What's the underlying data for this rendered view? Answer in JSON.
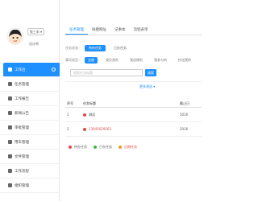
{
  "sidebar": {
    "user_button": "张三丰 ▾",
    "user_role": "设计师",
    "items": [
      {
        "label": "工作台",
        "active": true
      },
      {
        "label": "任务管理"
      },
      {
        "label": "工作报告"
      },
      {
        "label": "新闻公告"
      },
      {
        "label": "审批管理"
      },
      {
        "label": "用车管理"
      },
      {
        "label": "文件管理"
      },
      {
        "label": "工作流程"
      },
      {
        "label": "组织管理"
      }
    ]
  },
  "tabs": [
    "任务管理",
    "快捷网址",
    "记事本",
    "流程表单"
  ],
  "filters": {
    "status_label": "任务状态：",
    "status_options": [
      "待办任务",
      "已办任务"
    ],
    "type_label": "事项类型：",
    "type_options": [
      "全部",
      "我负责的",
      "我创建的",
      "我参与的",
      "抄送我的"
    ]
  },
  "search": {
    "placeholder": "搜索任务标题",
    "button": "搜索",
    "more": "更多筛选 ▾"
  },
  "table": {
    "headers": [
      "序号",
      "任务标题",
      "截止日"
    ],
    "rows": [
      {
        "index": "1",
        "title": "测试",
        "title_color": "#333333",
        "dot_color": "#e04b4b",
        "date": "2016"
      },
      {
        "index": "2",
        "title": "13945629563",
        "title_color": "#e04b4b",
        "dot_color": "#e04b4b",
        "date": "2016"
      }
    ]
  },
  "legend": [
    {
      "label": "待办任务",
      "color": "#e04b4b"
    },
    {
      "label": "已办任务",
      "color": "#3bb84a"
    },
    {
      "label": "过期任务",
      "color": "#e8a020"
    }
  ],
  "colors": {
    "accent": "#1e90ff"
  }
}
